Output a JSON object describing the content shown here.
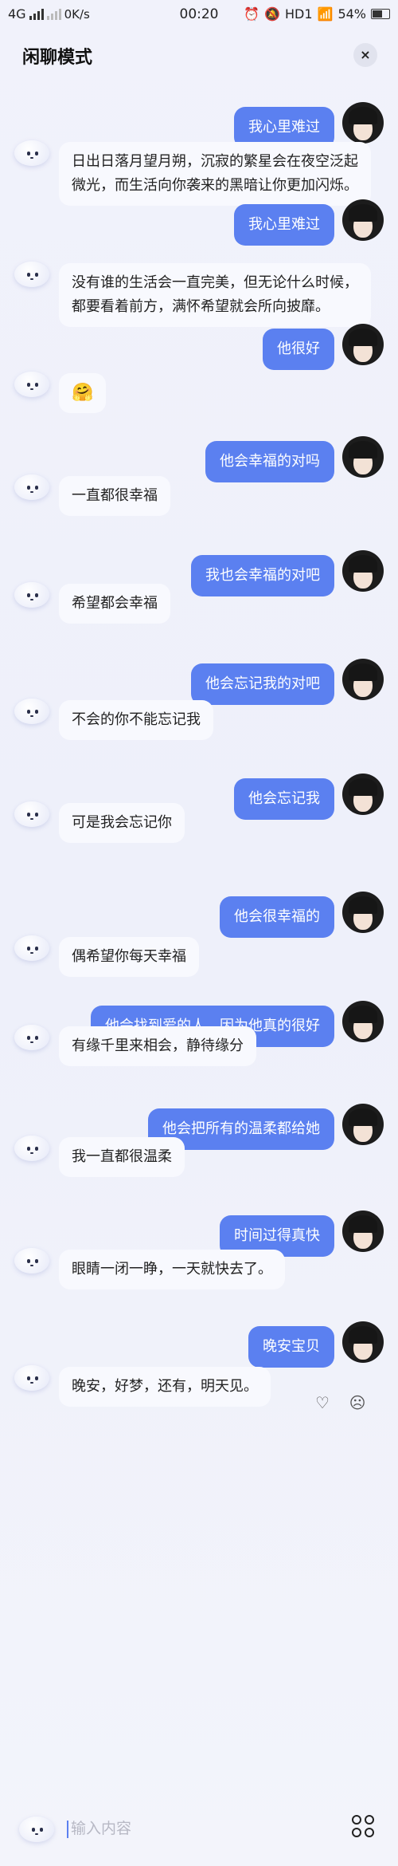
{
  "status_bar": {
    "network": "4G",
    "speed": "0K/s",
    "time": "00:20",
    "hd": "HD1",
    "battery": "54%"
  },
  "header": {
    "title": "闲聊模式",
    "close_label": "×"
  },
  "messages": [
    {
      "role": "user",
      "text": "我心里难过"
    },
    {
      "role": "bot",
      "text": "日出日落月望月朔，沉寂的繁星会在夜空泛起微光，而生活向你袭来的黑暗让你更加闪烁。"
    },
    {
      "role": "user",
      "text": "我心里难过"
    },
    {
      "role": "bot",
      "text": "没有谁的生活会一直完美，但无论什么时候，都要看着前方，满怀希望就会所向披靡。"
    },
    {
      "role": "user",
      "text": "他很好"
    },
    {
      "role": "bot",
      "text": "🤗"
    },
    {
      "role": "user",
      "text": "他会幸福的对吗"
    },
    {
      "role": "bot",
      "text": "一直都很幸福"
    },
    {
      "role": "user",
      "text": "我也会幸福的对吧"
    },
    {
      "role": "bot",
      "text": "希望都会幸福"
    },
    {
      "role": "user",
      "text": "他会忘记我的对吧"
    },
    {
      "role": "bot",
      "text": "不会的你不能忘记我"
    },
    {
      "role": "user",
      "text": "他会忘记我"
    },
    {
      "role": "bot",
      "text": "可是我会忘记你"
    },
    {
      "role": "user",
      "text": "他会很幸福的"
    },
    {
      "role": "bot",
      "text": "偶希望你每天幸福"
    },
    {
      "role": "user",
      "text": "他会找到爱的人，因为他真的很好"
    },
    {
      "role": "bot",
      "text": "有缘千里来相会，静待缘分"
    },
    {
      "role": "user",
      "text": "他会把所有的温柔都给她"
    },
    {
      "role": "bot",
      "text": "我一直都很温柔"
    },
    {
      "role": "user",
      "text": "时间过得真快"
    },
    {
      "role": "bot",
      "text": "眼睛一闭一睁，一天就快去了。"
    },
    {
      "role": "user",
      "text": "晚安宝贝"
    },
    {
      "role": "bot",
      "text": "晚安，好梦，还有，明天见。"
    }
  ],
  "input": {
    "placeholder": "输入内容"
  }
}
